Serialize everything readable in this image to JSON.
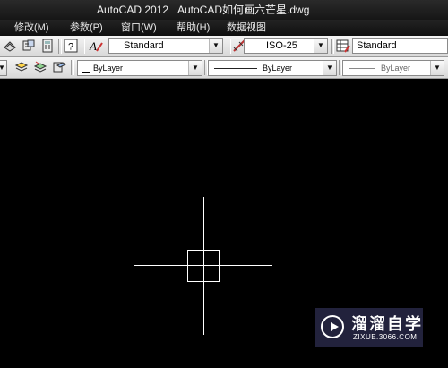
{
  "titlebar": {
    "app": "AutoCAD 2012",
    "document": "AutoCAD如何画六芒星.dwg"
  },
  "menu": {
    "items": [
      {
        "label": "修改(M)"
      },
      {
        "label": "参数(P)"
      },
      {
        "label": "窗口(W)"
      },
      {
        "label": "帮助(H)"
      },
      {
        "label": "数据视图"
      }
    ]
  },
  "toolbar1": {
    "text_style": "Standard",
    "dim_style": "ISO-25",
    "table_style": "Standard",
    "icons": [
      "properties-icon",
      "match-properties-icon",
      "calculator-icon",
      "help-icon",
      "text-style-icon",
      "dim-style-icon",
      "table-style-icon"
    ]
  },
  "toolbar2": {
    "color": "ByLayer",
    "linetype": "ByLayer",
    "lineweight": "ByLayer",
    "icons": [
      "layer-previous-icon",
      "layer-states-icon",
      "layer-isolate-icon",
      "color-swatch-icon"
    ]
  },
  "watermark": {
    "name": "溜溜自学",
    "url": "ZIXUE.3066.COM"
  },
  "colors": {
    "canvas": "#000000",
    "crosshair": "#ffffff"
  }
}
